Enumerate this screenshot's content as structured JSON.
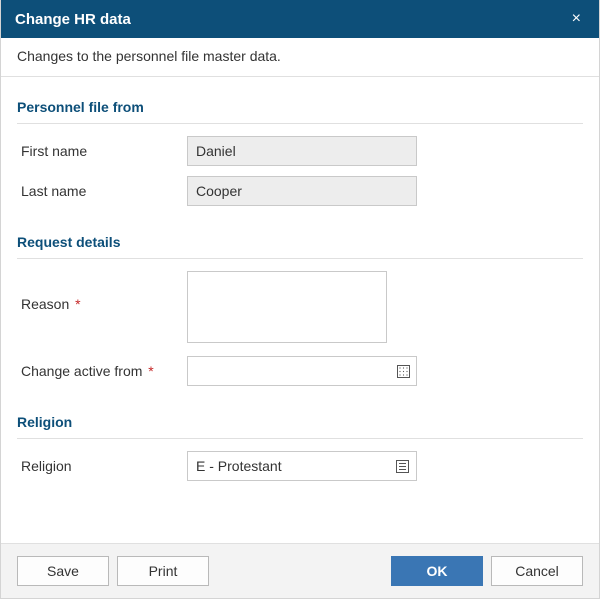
{
  "dialog": {
    "title": "Change HR data",
    "subtitle": "Changes to the personnel file master data."
  },
  "sections": {
    "personnel": {
      "title": "Personnel file from",
      "first_name_label": "First name",
      "first_name_value": "Daniel",
      "last_name_label": "Last name",
      "last_name_value": "Cooper"
    },
    "request": {
      "title": "Request details",
      "reason_label": "Reason",
      "reason_value": "",
      "change_from_label": "Change active from",
      "change_from_value": ""
    },
    "religion": {
      "title": "Religion",
      "religion_label": "Religion",
      "religion_value": "E - Protestant"
    }
  },
  "footer": {
    "save": "Save",
    "print": "Print",
    "ok": "OK",
    "cancel": "Cancel"
  }
}
